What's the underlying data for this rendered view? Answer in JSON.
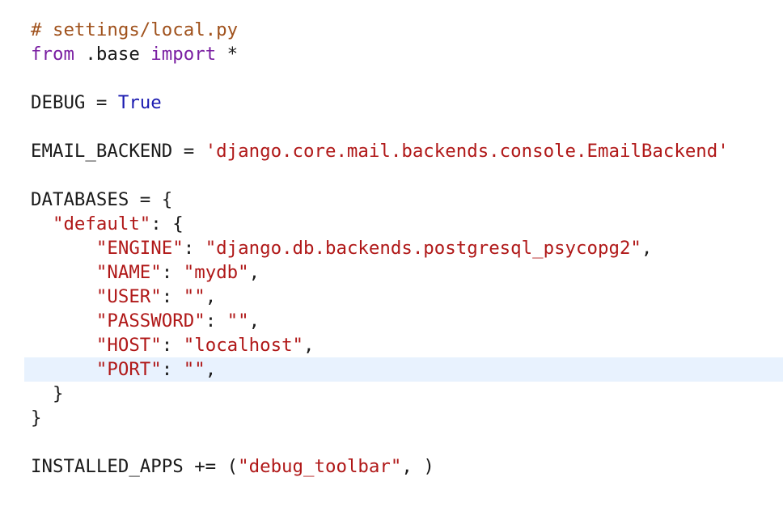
{
  "editor": {
    "colors": {
      "comment": "#a0521d",
      "keyword": "#7a1fa2",
      "builtin": "#1a1ab0",
      "string": "#b01818",
      "plain": "#1a1a1a",
      "current_line_highlight": "#e8f2fe"
    },
    "lines": [
      [
        {
          "t": "comment",
          "v": "# settings/local.py"
        }
      ],
      [
        {
          "t": "keyword",
          "v": "from"
        },
        {
          "t": "plain",
          "v": " .base "
        },
        {
          "t": "keyword",
          "v": "import"
        },
        {
          "t": "plain",
          "v": " *"
        }
      ],
      [],
      [
        {
          "t": "plain",
          "v": "DEBUG = "
        },
        {
          "t": "builtin",
          "v": "True"
        }
      ],
      [],
      [
        {
          "t": "plain",
          "v": "EMAIL_BACKEND = "
        },
        {
          "t": "string",
          "v": "'django.core.mail.backends.console.EmailBackend'"
        }
      ],
      [],
      [
        {
          "t": "plain",
          "v": "DATABASES = {"
        }
      ],
      [
        {
          "t": "plain",
          "v": "  "
        },
        {
          "t": "string",
          "v": "\"default\""
        },
        {
          "t": "plain",
          "v": ": {"
        }
      ],
      [
        {
          "t": "plain",
          "v": "      "
        },
        {
          "t": "string",
          "v": "\"ENGINE\""
        },
        {
          "t": "plain",
          "v": ": "
        },
        {
          "t": "string",
          "v": "\"django.db.backends.postgresql_psycopg2\""
        },
        {
          "t": "plain",
          "v": ","
        }
      ],
      [
        {
          "t": "plain",
          "v": "      "
        },
        {
          "t": "string",
          "v": "\"NAME\""
        },
        {
          "t": "plain",
          "v": ": "
        },
        {
          "t": "string",
          "v": "\"mydb\""
        },
        {
          "t": "plain",
          "v": ","
        }
      ],
      [
        {
          "t": "plain",
          "v": "      "
        },
        {
          "t": "string",
          "v": "\"USER\""
        },
        {
          "t": "plain",
          "v": ": "
        },
        {
          "t": "string",
          "v": "\"\""
        },
        {
          "t": "plain",
          "v": ","
        }
      ],
      [
        {
          "t": "plain",
          "v": "      "
        },
        {
          "t": "string",
          "v": "\"PASSWORD\""
        },
        {
          "t": "plain",
          "v": ": "
        },
        {
          "t": "string",
          "v": "\"\""
        },
        {
          "t": "plain",
          "v": ","
        }
      ],
      [
        {
          "t": "plain",
          "v": "      "
        },
        {
          "t": "string",
          "v": "\"HOST\""
        },
        {
          "t": "plain",
          "v": ": "
        },
        {
          "t": "string",
          "v": "\"localhost\""
        },
        {
          "t": "plain",
          "v": ","
        }
      ],
      [
        {
          "t": "plain",
          "v": "      "
        },
        {
          "t": "string",
          "v": "\"PORT\""
        },
        {
          "t": "plain",
          "v": ": "
        },
        {
          "t": "string",
          "v": "\"\""
        },
        {
          "t": "plain",
          "v": ","
        }
      ],
      [
        {
          "t": "plain",
          "v": "  }"
        }
      ],
      [
        {
          "t": "plain",
          "v": "}"
        }
      ],
      [],
      [
        {
          "t": "plain",
          "v": "INSTALLED_APPS += ("
        },
        {
          "t": "string",
          "v": "\"debug_toolbar\""
        },
        {
          "t": "plain",
          "v": ", )"
        }
      ]
    ]
  }
}
